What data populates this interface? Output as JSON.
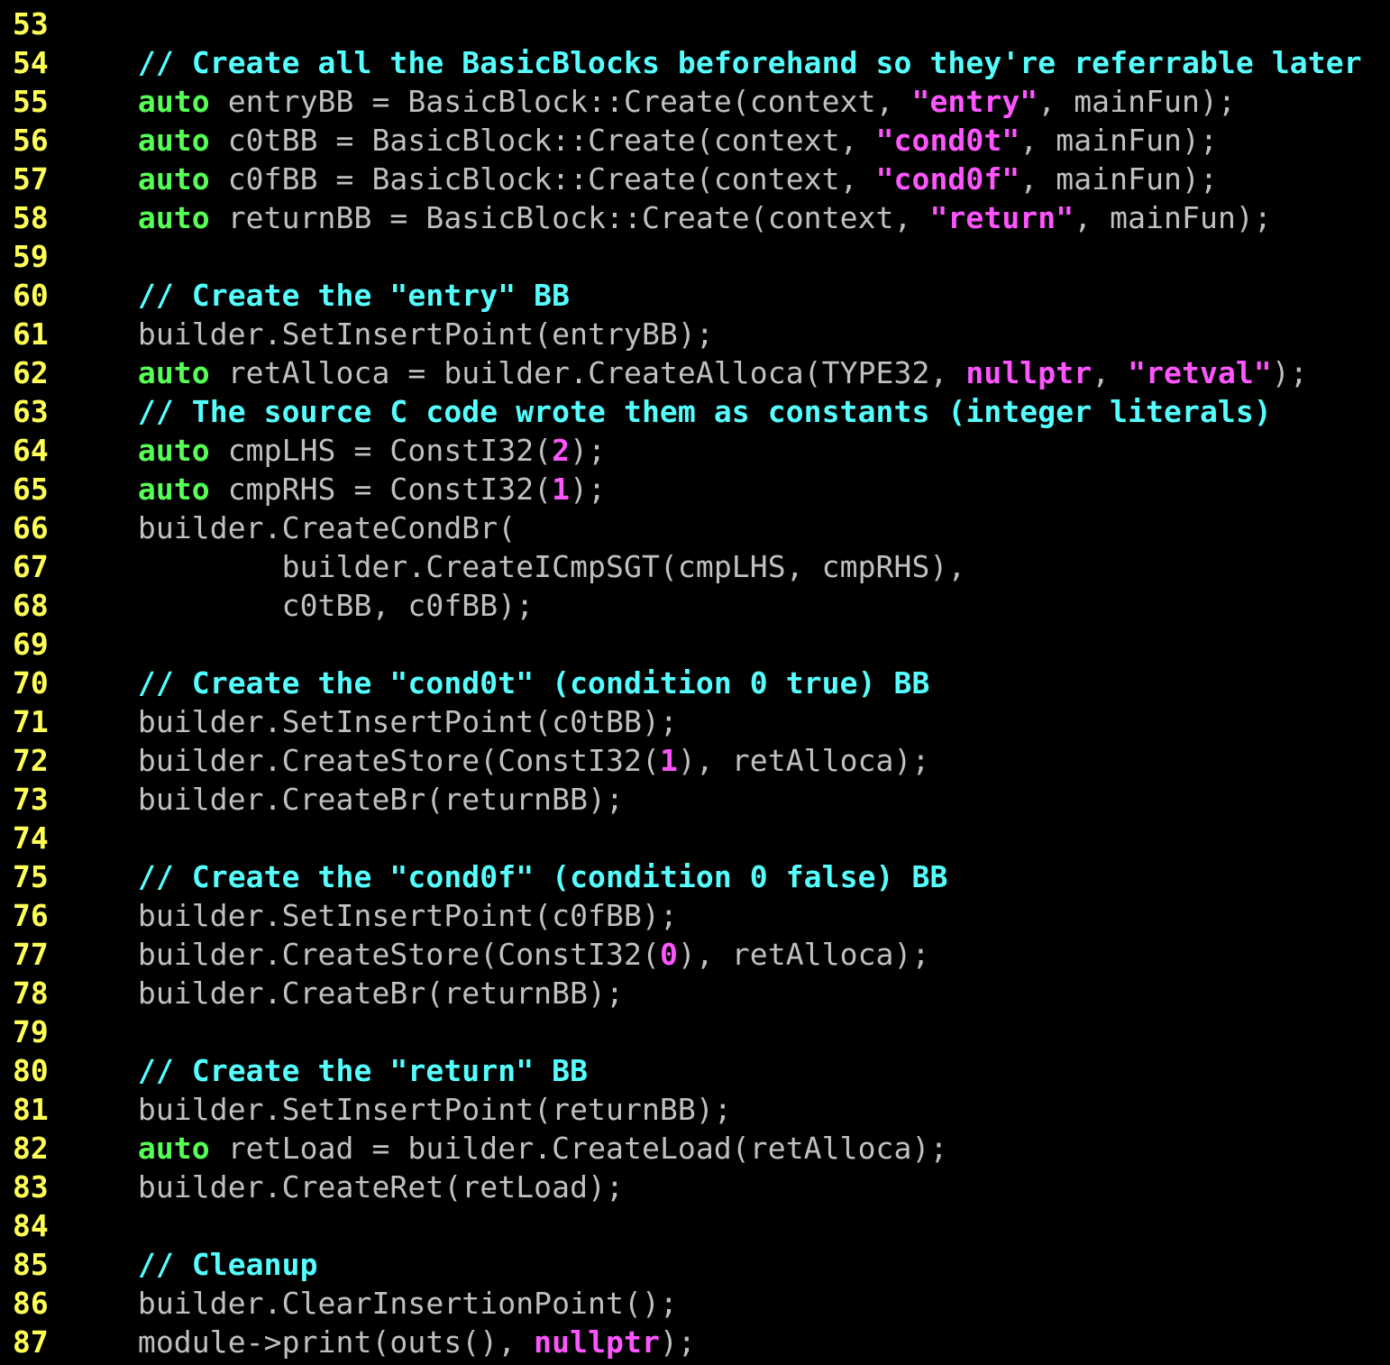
{
  "colors": {
    "background": "#000000",
    "line_number": "#ffff55",
    "comment": "#55ffff",
    "keyword": "#55ff55",
    "literal": "#ff55ff",
    "text": "#c0c0c0"
  },
  "lines": [
    {
      "n": "53",
      "tokens": []
    },
    {
      "n": "54",
      "tokens": [
        [
          "comment",
          "    // Create all the BasicBlocks beforehand so they're referrable later"
        ]
      ]
    },
    {
      "n": "55",
      "tokens": [
        [
          "keyword",
          "    auto"
        ],
        [
          "plain",
          " entryBB = BasicBlock::Create(context, "
        ],
        [
          "string",
          "\"entry\""
        ],
        [
          "plain",
          ", mainFun);"
        ]
      ]
    },
    {
      "n": "56",
      "tokens": [
        [
          "keyword",
          "    auto"
        ],
        [
          "plain",
          " c0tBB = BasicBlock::Create(context, "
        ],
        [
          "string",
          "\"cond0t\""
        ],
        [
          "plain",
          ", mainFun);"
        ]
      ]
    },
    {
      "n": "57",
      "tokens": [
        [
          "keyword",
          "    auto"
        ],
        [
          "plain",
          " c0fBB = BasicBlock::Create(context, "
        ],
        [
          "string",
          "\"cond0f\""
        ],
        [
          "plain",
          ", mainFun);"
        ]
      ]
    },
    {
      "n": "58",
      "tokens": [
        [
          "keyword",
          "    auto"
        ],
        [
          "plain",
          " returnBB = BasicBlock::Create(context, "
        ],
        [
          "string",
          "\"return\""
        ],
        [
          "plain",
          ", mainFun);"
        ]
      ]
    },
    {
      "n": "59",
      "tokens": []
    },
    {
      "n": "60",
      "tokens": [
        [
          "comment",
          "    // Create the \"entry\" BB"
        ]
      ]
    },
    {
      "n": "61",
      "tokens": [
        [
          "plain",
          "    builder.SetInsertPoint(entryBB);"
        ]
      ]
    },
    {
      "n": "62",
      "tokens": [
        [
          "keyword",
          "    auto"
        ],
        [
          "plain",
          " retAlloca = builder.CreateAlloca(TYPE32, "
        ],
        [
          "string",
          "nullptr"
        ],
        [
          "plain",
          ", "
        ],
        [
          "string",
          "\"retval\""
        ],
        [
          "plain",
          ");"
        ]
      ]
    },
    {
      "n": "63",
      "tokens": [
        [
          "comment",
          "    // The source C code wrote them as constants (integer literals)"
        ]
      ]
    },
    {
      "n": "64",
      "tokens": [
        [
          "keyword",
          "    auto"
        ],
        [
          "plain",
          " cmpLHS = ConstI32("
        ],
        [
          "number",
          "2"
        ],
        [
          "plain",
          ");"
        ]
      ]
    },
    {
      "n": "65",
      "tokens": [
        [
          "keyword",
          "    auto"
        ],
        [
          "plain",
          " cmpRHS = ConstI32("
        ],
        [
          "number",
          "1"
        ],
        [
          "plain",
          ");"
        ]
      ]
    },
    {
      "n": "66",
      "tokens": [
        [
          "plain",
          "    builder.CreateCondBr("
        ]
      ]
    },
    {
      "n": "67",
      "tokens": [
        [
          "plain",
          "            builder.CreateICmpSGT(cmpLHS, cmpRHS),"
        ]
      ]
    },
    {
      "n": "68",
      "tokens": [
        [
          "plain",
          "            c0tBB, c0fBB);"
        ]
      ]
    },
    {
      "n": "69",
      "tokens": []
    },
    {
      "n": "70",
      "tokens": [
        [
          "comment",
          "    // Create the \"cond0t\" (condition 0 true) BB"
        ]
      ]
    },
    {
      "n": "71",
      "tokens": [
        [
          "plain",
          "    builder.SetInsertPoint(c0tBB);"
        ]
      ]
    },
    {
      "n": "72",
      "tokens": [
        [
          "plain",
          "    builder.CreateStore(ConstI32("
        ],
        [
          "number",
          "1"
        ],
        [
          "plain",
          "), retAlloca);"
        ]
      ]
    },
    {
      "n": "73",
      "tokens": [
        [
          "plain",
          "    builder.CreateBr(returnBB);"
        ]
      ]
    },
    {
      "n": "74",
      "tokens": []
    },
    {
      "n": "75",
      "tokens": [
        [
          "comment",
          "    // Create the \"cond0f\" (condition 0 false) BB"
        ]
      ]
    },
    {
      "n": "76",
      "tokens": [
        [
          "plain",
          "    builder.SetInsertPoint(c0fBB);"
        ]
      ]
    },
    {
      "n": "77",
      "tokens": [
        [
          "plain",
          "    builder.CreateStore(ConstI32("
        ],
        [
          "number",
          "0"
        ],
        [
          "plain",
          "), retAlloca);"
        ]
      ]
    },
    {
      "n": "78",
      "tokens": [
        [
          "plain",
          "    builder.CreateBr(returnBB);"
        ]
      ]
    },
    {
      "n": "79",
      "tokens": []
    },
    {
      "n": "80",
      "tokens": [
        [
          "comment",
          "    // Create the \"return\" BB"
        ]
      ]
    },
    {
      "n": "81",
      "tokens": [
        [
          "plain",
          "    builder.SetInsertPoint(returnBB);"
        ]
      ]
    },
    {
      "n": "82",
      "tokens": [
        [
          "keyword",
          "    auto"
        ],
        [
          "plain",
          " retLoad = builder.CreateLoad(retAlloca);"
        ]
      ]
    },
    {
      "n": "83",
      "tokens": [
        [
          "plain",
          "    builder.CreateRet(retLoad);"
        ]
      ]
    },
    {
      "n": "84",
      "tokens": []
    },
    {
      "n": "85",
      "tokens": [
        [
          "comment",
          "    // Cleanup"
        ]
      ]
    },
    {
      "n": "86",
      "tokens": [
        [
          "plain",
          "    builder.ClearInsertionPoint();"
        ]
      ]
    },
    {
      "n": "87",
      "tokens": [
        [
          "plain",
          "    module->print(outs(), "
        ],
        [
          "string",
          "nullptr"
        ],
        [
          "plain",
          ");"
        ]
      ]
    }
  ]
}
